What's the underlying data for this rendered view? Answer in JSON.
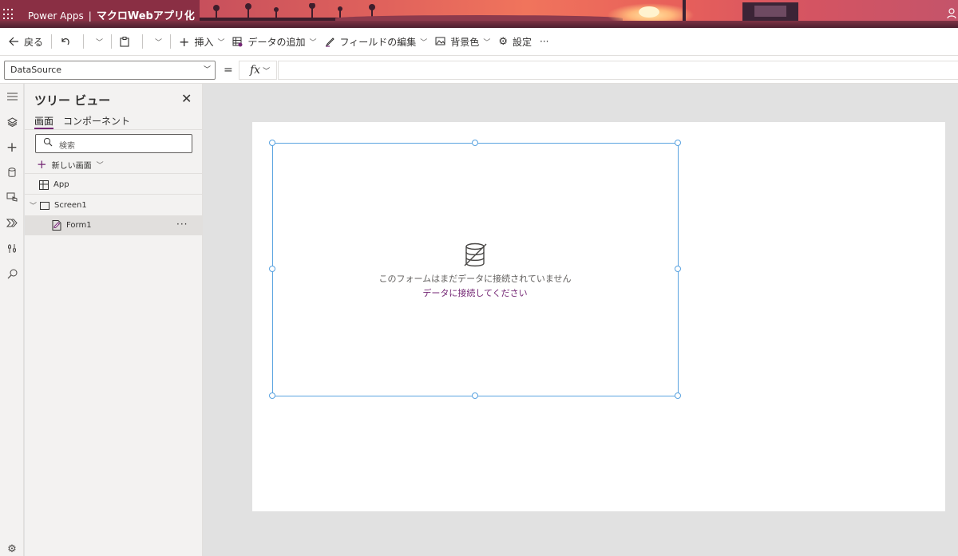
{
  "titlebar": {
    "app_name": "Power Apps",
    "separator": "|",
    "project_name": "マクロWebアプリ化"
  },
  "commandbar": {
    "back": "戻る",
    "insert": "挿入",
    "add_data": "データの追加",
    "edit_fields": "フィールドの編集",
    "background_color": "背景色",
    "settings": "設定",
    "more": "···"
  },
  "formula": {
    "property": "DataSource",
    "equals": "=",
    "fx": "fx",
    "value": ""
  },
  "tree": {
    "title": "ツリー ビュー",
    "tabs": [
      "画面",
      "コンポーネント"
    ],
    "search_placeholder": "検索",
    "new_screen": "新しい画面",
    "nodes": {
      "app": "App",
      "screen": "Screen1",
      "form": "Form1"
    },
    "more": "···"
  },
  "form": {
    "message": "このフォームはまだデータに接続されていません",
    "link": "データに接続してください"
  },
  "colors": {
    "accent": "#742774",
    "selection": "#5aa3e0",
    "canvas_bg": "#e1e1e1"
  },
  "icons": {
    "rail": [
      "hamburger-icon",
      "layers-icon",
      "plus-icon",
      "database-icon",
      "media-icon",
      "power-automate-icon",
      "tools-icon",
      "search-icon",
      "gear-icon"
    ]
  }
}
